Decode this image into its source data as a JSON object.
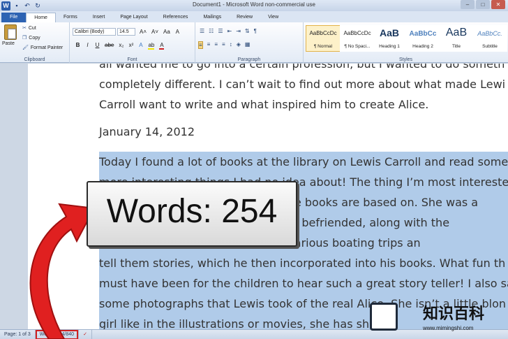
{
  "window": {
    "title": "Document1 - Microsoft Word non-commercial use",
    "minimize": "–",
    "maximize": "□",
    "close": "✕"
  },
  "quick_access": {
    "logo": "W",
    "save": "▪",
    "undo": "↶",
    "redo": "↻"
  },
  "tabs": [
    {
      "label": "File"
    },
    {
      "label": "Home"
    },
    {
      "label": "Forms"
    },
    {
      "label": "Insert"
    },
    {
      "label": "Page Layout"
    },
    {
      "label": "References"
    },
    {
      "label": "Mailings"
    },
    {
      "label": "Review"
    },
    {
      "label": "View"
    }
  ],
  "ribbon": {
    "clipboard": {
      "paste": "Paste",
      "cut": "Cut",
      "copy": "Copy",
      "format_painter": "Format Painter",
      "group_label": "Clipboard"
    },
    "font": {
      "family": "Calibri (Body)",
      "size": "14.5",
      "grow": "A˄",
      "shrink": "A˅",
      "change_case": "Aa",
      "clear": "A",
      "bold": "B",
      "italic": "I",
      "underline": "U",
      "strike": "abe",
      "sub": "x₂",
      "sup": "x²",
      "effects": "A",
      "highlight": "ab",
      "color": "A",
      "group_label": "Font"
    },
    "paragraph": {
      "group_label": "Paragraph",
      "pilcrow": "¶"
    },
    "styles": {
      "group_label": "Styles",
      "items": [
        {
          "sample": "AaBbCcDc",
          "name": "¶ Normal"
        },
        {
          "sample": "AaBbCcDc",
          "name": "¶ No Spaci..."
        },
        {
          "sample": "AaB",
          "name": "Heading 1"
        },
        {
          "sample": "AaBbCc",
          "name": "Heading 2"
        },
        {
          "sample": "AaB",
          "name": "Title"
        },
        {
          "sample": "AaBbCc.",
          "name": "Subtitle"
        }
      ]
    }
  },
  "document": {
    "lines_top": [
      "all wanted me to go into a certain profession, but I wanted to do someth",
      "completely different. I can’t wait to find out more about what made Lewi",
      "Carroll want to write and what inspired him to create Alice."
    ],
    "date": "January 14, 2012",
    "selected_lines": [
      "Today I found a lot of books at the library on Lewis Carroll and read some",
      "more interesting things I had no idea about! The thing I’m most intereste",
      "learning about was the girl the Alice books are based on. She was a",
      "daughter of a friend, and Lewis had befriended, along with the",
      "children and took the children on various boating trips an",
      "tell them stories, which he then incorporated into his books. What fun th",
      "must have been for the children to hear such a great story teller! I also sa",
      "some photographs that Lewis took of the real Alice. She isn’t a little blon",
      "girl like in the illustrations or movies, she has short"
    ]
  },
  "status": {
    "page": "Page: 1 of 3",
    "words": "Words: 254/840",
    "proof_icon": "✓"
  },
  "overlay": {
    "words_label": "Words: 254"
  },
  "watermark": {
    "cn": "知识百科",
    "url": "www.mimingshi.com"
  }
}
